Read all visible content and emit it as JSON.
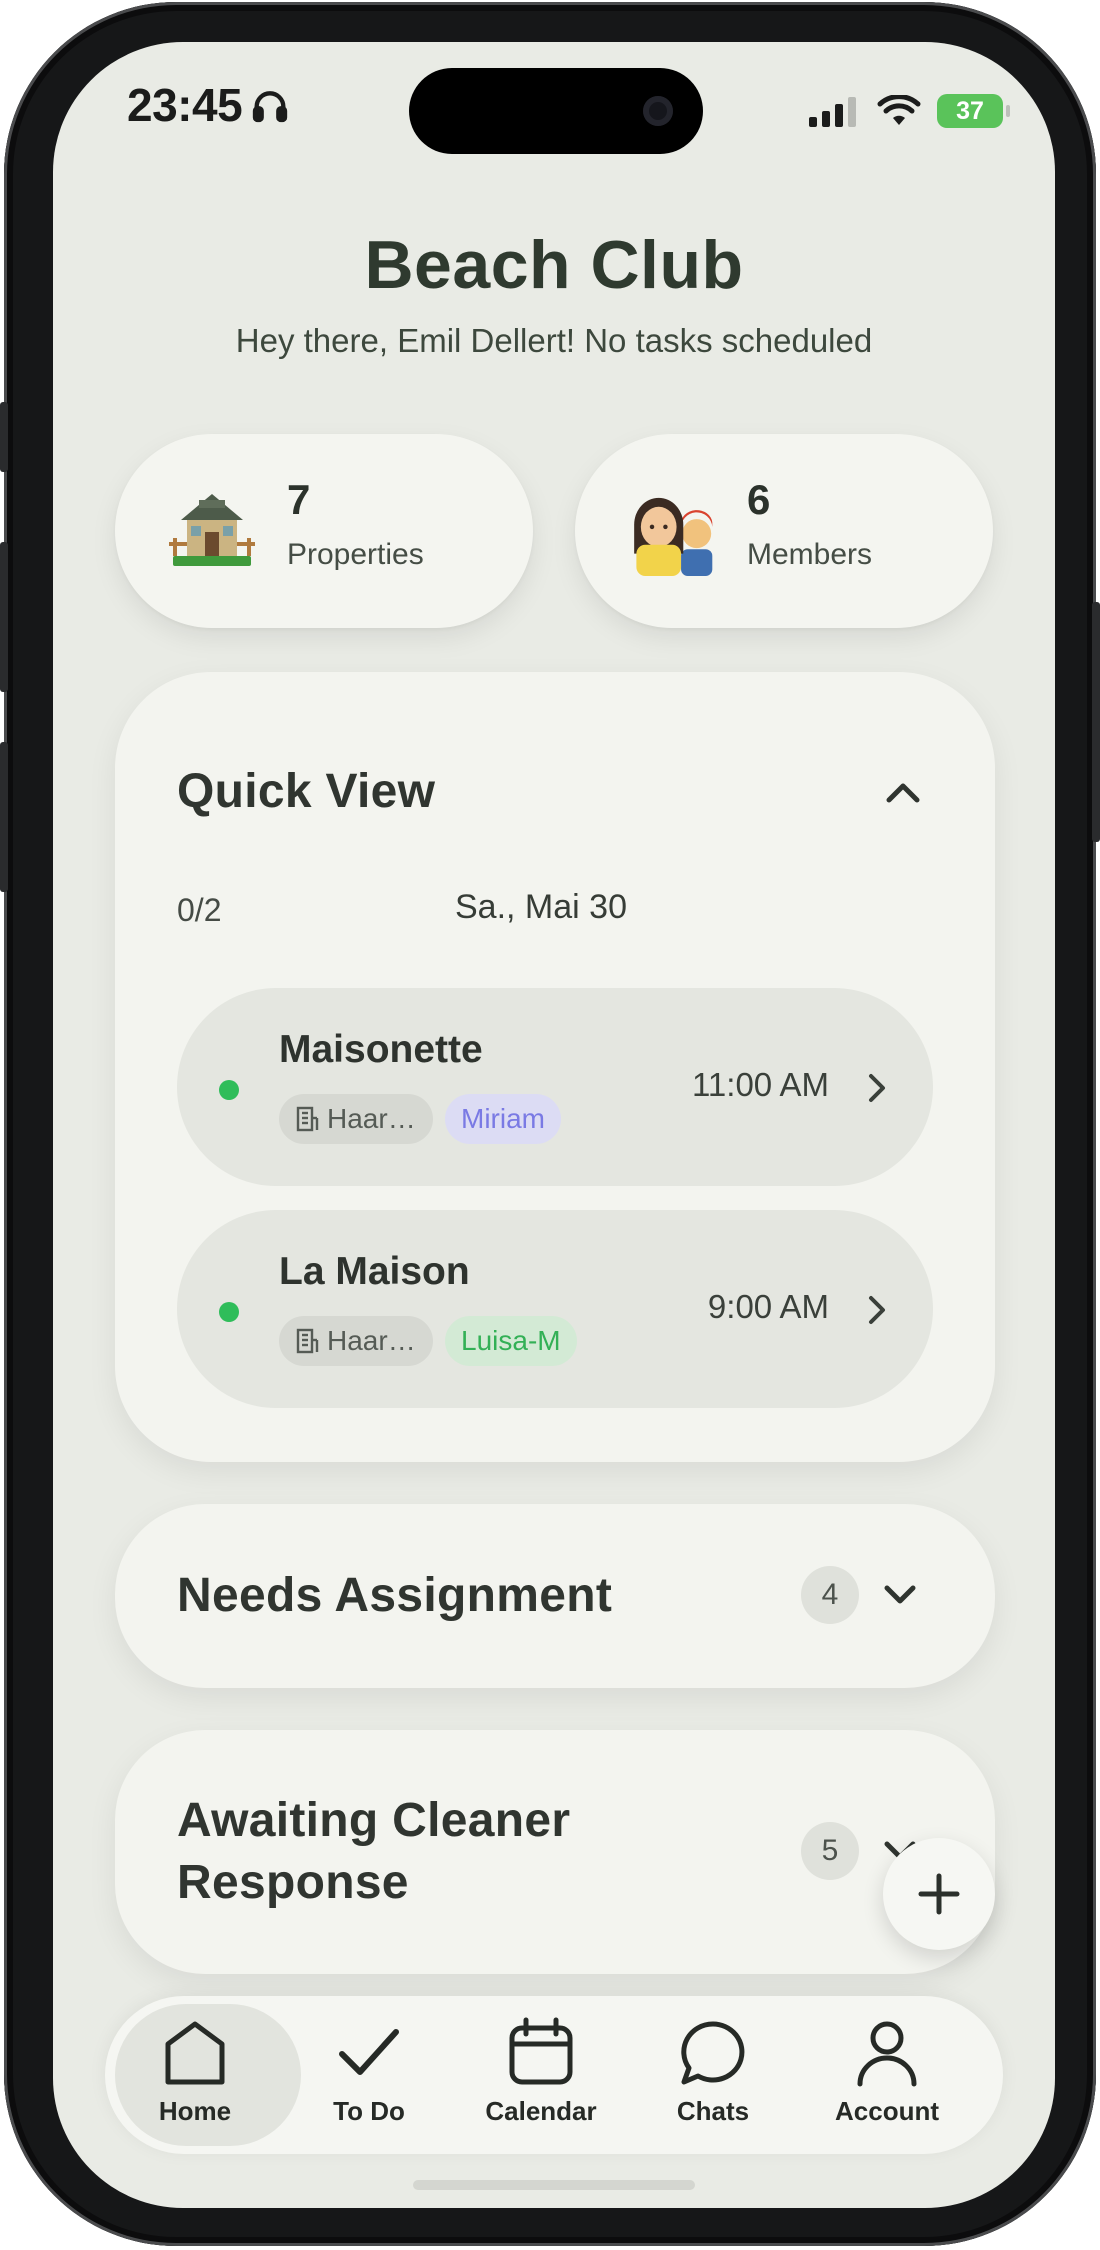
{
  "status_bar": {
    "time": "23:45",
    "battery": "37"
  },
  "header": {
    "title": "Beach Club",
    "greeting": "Hey there, Emil Dellert! No tasks scheduled"
  },
  "stats": {
    "properties": {
      "count": "7",
      "label": "Properties",
      "icon": "house-icon"
    },
    "members": {
      "count": "6",
      "label": "Members",
      "icon": "people-icon"
    }
  },
  "quick_view": {
    "title": "Quick View",
    "progress": "0/2",
    "date": "Sa., Mai 30",
    "tasks": [
      {
        "property": "Maisonette",
        "tag": "Haar…",
        "assignee": "Miriam",
        "time": "11:00 AM",
        "status_color": "#2fbd5a"
      },
      {
        "property": "La Maison",
        "tag": "Haar…",
        "assignee": "Luisa-M",
        "time": "9:00 AM",
        "status_color": "#2fbd5a"
      }
    ]
  },
  "sections": {
    "needs_assignment": {
      "title": "Needs Assignment",
      "count": "4"
    },
    "awaiting_response": {
      "title_line1": "Awaiting Cleaner",
      "title_line2": "Response",
      "count": "5"
    }
  },
  "fab": {
    "label": "+",
    "icon": "plus-icon"
  },
  "nav": {
    "items": [
      {
        "label": "Home",
        "icon": "home-icon",
        "active": true
      },
      {
        "label": "To Do",
        "icon": "check-icon",
        "active": false
      },
      {
        "label": "Calendar",
        "icon": "calendar-icon",
        "active": false
      },
      {
        "label": "Chats",
        "icon": "chat-icon",
        "active": false
      },
      {
        "label": "Account",
        "icon": "user-icon",
        "active": false
      }
    ]
  },
  "colors": {
    "background": "#e9ebe5",
    "card": "#f3f4ef",
    "accent_green": "#2fbd5a",
    "assignee_blue": "#7a7ae4",
    "assignee_green": "#33b056"
  }
}
